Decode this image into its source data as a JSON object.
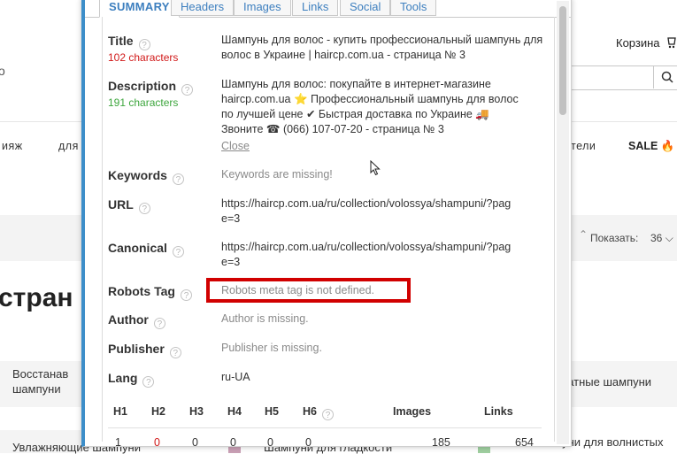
{
  "background": {
    "logo_fragment": "о",
    "cart_label": "Корзина",
    "nav": [
      "ияж",
      "для",
      "тели",
      "SALE"
    ],
    "show_label": "Показать:",
    "show_value": "36",
    "heading_fragment": "стран",
    "cards": [
      "Восстанав",
      "шампуни",
      "ратные шампуни",
      "Увлажняющие шампуни",
      "Шампуни для гладкости",
      "Шампуни для волнистых"
    ]
  },
  "popup": {
    "tabs": [
      "SUMMARY",
      "Headers",
      "Images",
      "Links",
      "Social",
      "Tools"
    ],
    "help_glyph": "?",
    "title": {
      "label": "Title",
      "count": "102 characters",
      "value": "Шампунь для волос - купить профессиональный шампунь для волос в Украине | haircp.com.ua - страница № 3"
    },
    "description": {
      "label": "Description",
      "count": "191 characters",
      "line1": "Шампунь для волос: покупайте в интернет-магазине",
      "line2": "haircp.com.ua ⭐ Профессиональный шампунь для волос",
      "line3": "по лучшей цене ✔ Быстрая доставка по Украине 🚚",
      "line4": "Звоните ☎ (066) 107-07-20 - страница № 3",
      "close": "Close"
    },
    "keywords": {
      "label": "Keywords",
      "value": "Keywords are missing!"
    },
    "url": {
      "label": "URL",
      "value": "https://haircp.com.ua/ru/collection/volossya/shampuni/?page=3"
    },
    "canonical": {
      "label": "Canonical",
      "value": "https://haircp.com.ua/ru/collection/volossya/shampuni/?page=3"
    },
    "robots": {
      "label": "Robots Tag",
      "value": "Robots meta tag is not defined."
    },
    "author": {
      "label": "Author",
      "value": "Author is missing."
    },
    "publisher": {
      "label": "Publisher",
      "value": "Publisher is missing."
    },
    "lang": {
      "label": "Lang",
      "value": "ru-UA"
    },
    "headings_table": {
      "columns": [
        "H1",
        "H2",
        "H3",
        "H4",
        "H5",
        "H6",
        "Images",
        "Links"
      ],
      "values": [
        "1",
        "0",
        "0",
        "0",
        "0",
        "0",
        "185",
        "654"
      ]
    }
  },
  "colors": {
    "accent": "#3d8ec9",
    "count_bad": "#d11919",
    "count_good": "#3da63d",
    "highlight": "#d10000"
  }
}
